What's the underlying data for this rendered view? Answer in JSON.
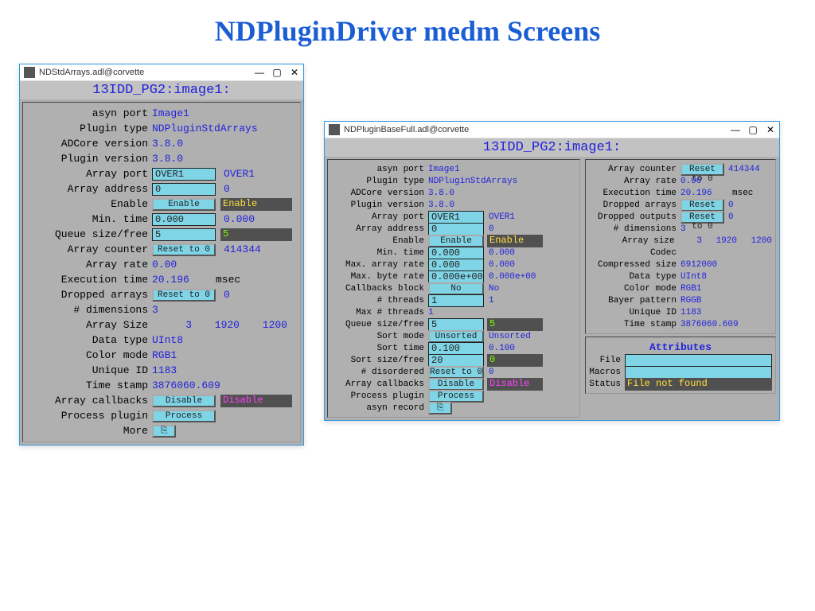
{
  "slide": {
    "title": "NDPluginDriver medm Screens"
  },
  "win1": {
    "title": "NDStdArrays.adl@corvette",
    "screen_title": "13IDD_PG2:image1:",
    "rows": {
      "asyn_port_lbl": "asyn port",
      "asyn_port_val": "Image1",
      "plugin_type_lbl": "Plugin type",
      "plugin_type_val": "NDPluginStdArrays",
      "adcore_lbl": "ADCore version",
      "adcore_val": "3.8.0",
      "plugver_lbl": "Plugin version",
      "plugver_val": "3.8.0",
      "array_port_lbl": "Array port",
      "array_port_inp": "OVER1",
      "array_port_val": "OVER1",
      "array_addr_lbl": "Array address",
      "array_addr_inp": "0",
      "array_addr_val": "0",
      "enable_lbl": "Enable",
      "enable_btn": "Enable",
      "enable_state": "Enable",
      "mintime_lbl": "Min. time",
      "mintime_inp": "0.000",
      "mintime_val": "0.000",
      "queue_lbl": "Queue size/free",
      "queue_inp": "5",
      "queue_state": "5",
      "counter_lbl": "Array counter",
      "counter_btn": "Reset to 0",
      "counter_val": "414344",
      "rate_lbl": "Array rate",
      "rate_val": "0.00",
      "exec_lbl": "Execution time",
      "exec_val": "20.196",
      "exec_unit": "msec",
      "dropped_lbl": "Dropped arrays",
      "dropped_btn": "Reset to 0",
      "dropped_val": "0",
      "dims_lbl": "# dimensions",
      "dims_val": "3",
      "arrsize_lbl": "Array Size",
      "arrsize_a": "3",
      "arrsize_b": "1920",
      "arrsize_c": "1200",
      "dtype_lbl": "Data type",
      "dtype_val": "UInt8",
      "cmode_lbl": "Color mode",
      "cmode_val": "RGB1",
      "uid_lbl": "Unique ID",
      "uid_val": "1183",
      "tstamp_lbl": "Time stamp",
      "tstamp_val": "3876060.609",
      "acb_lbl": "Array callbacks",
      "acb_btn": "Disable",
      "acb_state": "Disable",
      "proc_lbl": "Process plugin",
      "proc_btn": "Process",
      "more_lbl": "More",
      "more_icon": "⎘"
    }
  },
  "win2": {
    "title": "NDPluginBaseFull.adl@corvette",
    "screen_title": "13IDD_PG2:image1:",
    "left": {
      "asyn_port_lbl": "asyn port",
      "asyn_port_val": "Image1",
      "plugin_type_lbl": "Plugin type",
      "plugin_type_val": "NDPluginStdArrays",
      "adcore_lbl": "ADCore version",
      "adcore_val": "3.8.0",
      "plugver_lbl": "Plugin version",
      "plugver_val": "3.8.0",
      "array_port_lbl": "Array port",
      "array_port_inp": "OVER1",
      "array_port_val": "OVER1",
      "array_addr_lbl": "Array address",
      "array_addr_inp": "0",
      "array_addr_val": "0",
      "enable_lbl": "Enable",
      "enable_btn": "Enable",
      "enable_state": "Enable",
      "mintime_lbl": "Min. time",
      "mintime_inp": "0.000",
      "mintime_val": "0.000",
      "maxarr_lbl": "Max. array rate",
      "maxarr_inp": "0.000",
      "maxarr_val": "0.000",
      "maxbyte_lbl": "Max. byte rate",
      "maxbyte_inp": "0.000e+00",
      "maxbyte_val": "0.000e+00",
      "cbblock_lbl": "Callbacks block",
      "cbblock_btn": "No",
      "cbblock_val": "No",
      "threads_lbl": "# threads",
      "threads_inp": "1",
      "threads_val": "1",
      "maxthreads_lbl": "Max # threads",
      "maxthreads_val": "1",
      "queue_lbl": "Queue size/free",
      "queue_inp": "5",
      "queue_state": "5",
      "sortmode_lbl": "Sort mode",
      "sortmode_btn": "Unsorted",
      "sortmode_val": "Unsorted",
      "sorttime_lbl": "Sort time",
      "sorttime_inp": "0.100",
      "sorttime_val": "0.100",
      "sortsize_lbl": "Sort size/free",
      "sortsize_inp": "20",
      "sortsize_state": "0",
      "disord_lbl": "# disordered",
      "disord_btn": "Reset to 0",
      "disord_val": "0",
      "acb_lbl": "Array callbacks",
      "acb_btn": "Disable",
      "acb_state": "Disable",
      "proc_lbl": "Process plugin",
      "proc_btn": "Process",
      "asynrec_lbl": "asyn record",
      "asynrec_icon": "⎘"
    },
    "right": {
      "counter_lbl": "Array counter",
      "counter_btn": "Reset to 0",
      "counter_val": "414344",
      "rate_lbl": "Array rate",
      "rate_val": "0.00",
      "exec_lbl": "Execution time",
      "exec_val": "20.196",
      "exec_unit": "msec",
      "dropa_lbl": "Dropped arrays",
      "dropa_btn": "Reset to 0",
      "dropa_val": "0",
      "dropo_lbl": "Dropped outputs",
      "dropo_btn": "Reset to 0",
      "dropo_val": "0",
      "dims_lbl": "# dimensions",
      "dims_val": "3",
      "arrsize_lbl": "Array size",
      "arrsize_a": "3",
      "arrsize_b": "1920",
      "arrsize_c": "1200",
      "codec_lbl": "Codec",
      "compsize_lbl": "Compressed size",
      "compsize_val": "6912000",
      "dtype_lbl": "Data type",
      "dtype_val": "UInt8",
      "cmode_lbl": "Color mode",
      "cmode_val": "RGB1",
      "bayer_lbl": "Bayer pattern",
      "bayer_val": "RGGB",
      "uid_lbl": "Unique ID",
      "uid_val": "1183",
      "tstamp_lbl": "Time stamp",
      "tstamp_val": "3876060.609",
      "attr_title": "Attributes",
      "file_lbl": "File",
      "macros_lbl": "Macros",
      "status_lbl": "Status",
      "status_val": "File not found"
    }
  }
}
